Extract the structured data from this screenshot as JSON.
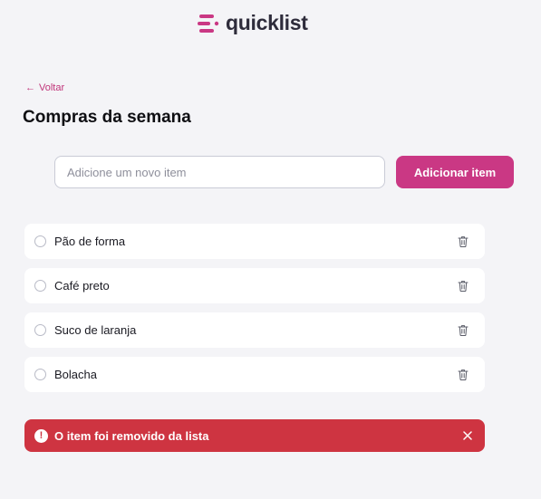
{
  "brand": {
    "name": "quicklist",
    "accent_color": "#CA3884"
  },
  "navigation": {
    "back_arrow": "←",
    "back_label": "Voltar"
  },
  "page": {
    "title": "Compras da semana"
  },
  "new_item_form": {
    "input_value": "",
    "input_placeholder": "Adicione um novo item",
    "add_button_label": "Adicionar item"
  },
  "list": {
    "items": [
      {
        "label": "Pão de forma",
        "checked": false,
        "icon": "trash-icon"
      },
      {
        "label": "Café preto",
        "checked": false,
        "icon": "trash-icon"
      },
      {
        "label": "Suco de laranja",
        "checked": false,
        "icon": "trash-icon"
      },
      {
        "label": "Bolacha",
        "checked": false,
        "icon": "trash-icon"
      }
    ]
  },
  "alert": {
    "icon_glyph": "!",
    "message": "O item foi removido da lista",
    "background_color": "#CE3441",
    "close_icon": "close-icon"
  }
}
